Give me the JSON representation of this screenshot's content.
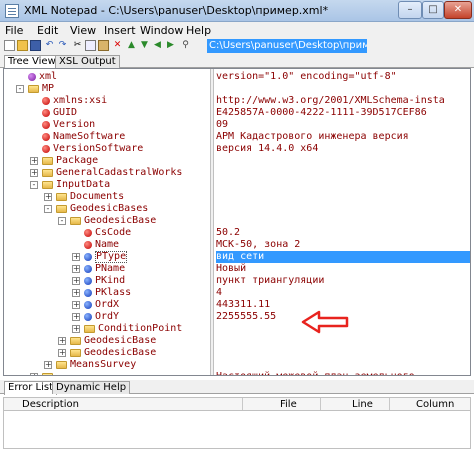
{
  "window": {
    "title": "XML Notepad - C:\\Users\\panuser\\Desktop\\пример.xml*",
    "min_glyph": "–",
    "max_glyph": "□",
    "close_glyph": "✕"
  },
  "menu": [
    "File",
    "Edit",
    "View",
    "Insert",
    "Window",
    "Help"
  ],
  "toolbar": {
    "icons": [
      "new-file",
      "open-folder",
      "save",
      "undo",
      "redo",
      "cut",
      "copy",
      "paste",
      "delete",
      "nudge-up",
      "nudge-down",
      "nudge-left",
      "nudge-right",
      "find"
    ],
    "path": "C:\\Users\\panuser\\Desktop\\пример.xml"
  },
  "tabs_top": [
    "Tree View",
    "XSL Output"
  ],
  "tree": [
    {
      "label": "xml",
      "kind": "pi",
      "value": "version=\"1.0\" encoding=\"utf-8\"",
      "selected": false
    },
    {
      "label": "MP",
      "kind": "folder",
      "value": "",
      "selected": false
    },
    {
      "label": "xmlns:xsi",
      "kind": "attr",
      "value": "http://www.w3.org/2001/XMLSchema-insta",
      "selected": false
    },
    {
      "label": "GUID",
      "kind": "attr",
      "value": "E425857A-0000-4222-1111-39D517CEF86",
      "selected": false
    },
    {
      "label": "Version",
      "kind": "attr",
      "value": "09",
      "selected": false
    },
    {
      "label": "NameSoftware",
      "kind": "attr",
      "value": "АРМ Кадастрового инженера версия",
      "selected": false
    },
    {
      "label": "VersionSoftware",
      "kind": "attr",
      "value": "версия 14.4.0 x64",
      "selected": false
    },
    {
      "label": "Package",
      "kind": "folder",
      "value": "",
      "selected": false
    },
    {
      "label": "GeneralCadastralWorks",
      "kind": "folder",
      "value": "",
      "selected": false
    },
    {
      "label": "InputData",
      "kind": "folder",
      "value": "",
      "selected": false
    },
    {
      "label": "Documents",
      "kind": "folder",
      "value": "",
      "selected": false
    },
    {
      "label": "GeodesicBases",
      "kind": "folder",
      "value": "",
      "selected": false
    },
    {
      "label": "GeodesicBase",
      "kind": "folder",
      "value": "",
      "selected": false
    },
    {
      "label": "CsCode",
      "kind": "attr",
      "value": "50.2",
      "selected": false
    },
    {
      "label": "Name",
      "kind": "attr",
      "value": "МСК-50, зона 2",
      "selected": false
    },
    {
      "label": "PType",
      "kind": "elem",
      "value": "вид сети",
      "selected": true
    },
    {
      "label": "PName",
      "kind": "elem",
      "value": "Новый",
      "selected": false
    },
    {
      "label": "PKind",
      "kind": "elem",
      "value": "пункт триангуляции",
      "selected": false
    },
    {
      "label": "PKlass",
      "kind": "elem",
      "value": "4",
      "selected": false
    },
    {
      "label": "OrdX",
      "kind": "elem",
      "value": "443311.11",
      "selected": false
    },
    {
      "label": "OrdY",
      "kind": "elem",
      "value": "2255555.55",
      "selected": false
    },
    {
      "label": "ConditionPoint",
      "kind": "folder",
      "value": "",
      "selected": false
    },
    {
      "label": "GeodesicBase",
      "kind": "folder",
      "value": "",
      "selected": false
    },
    {
      "label": "GeodesicBase",
      "kind": "folder",
      "value": "",
      "selected": false
    },
    {
      "label": "MeansSurvey",
      "kind": "folder",
      "value": "",
      "selected": false
    },
    {
      "label": "",
      "kind": "folder",
      "value": "Настоящий межевой план земельного",
      "selected": false
    }
  ],
  "tabs_bottom": [
    "Error List",
    "Dynamic Help"
  ],
  "error_columns": [
    "Description",
    "File",
    "Line",
    "Column"
  ],
  "colors": {
    "accent": "#3399ff",
    "callout": "#e8231e",
    "value_text": "#8b0000"
  }
}
